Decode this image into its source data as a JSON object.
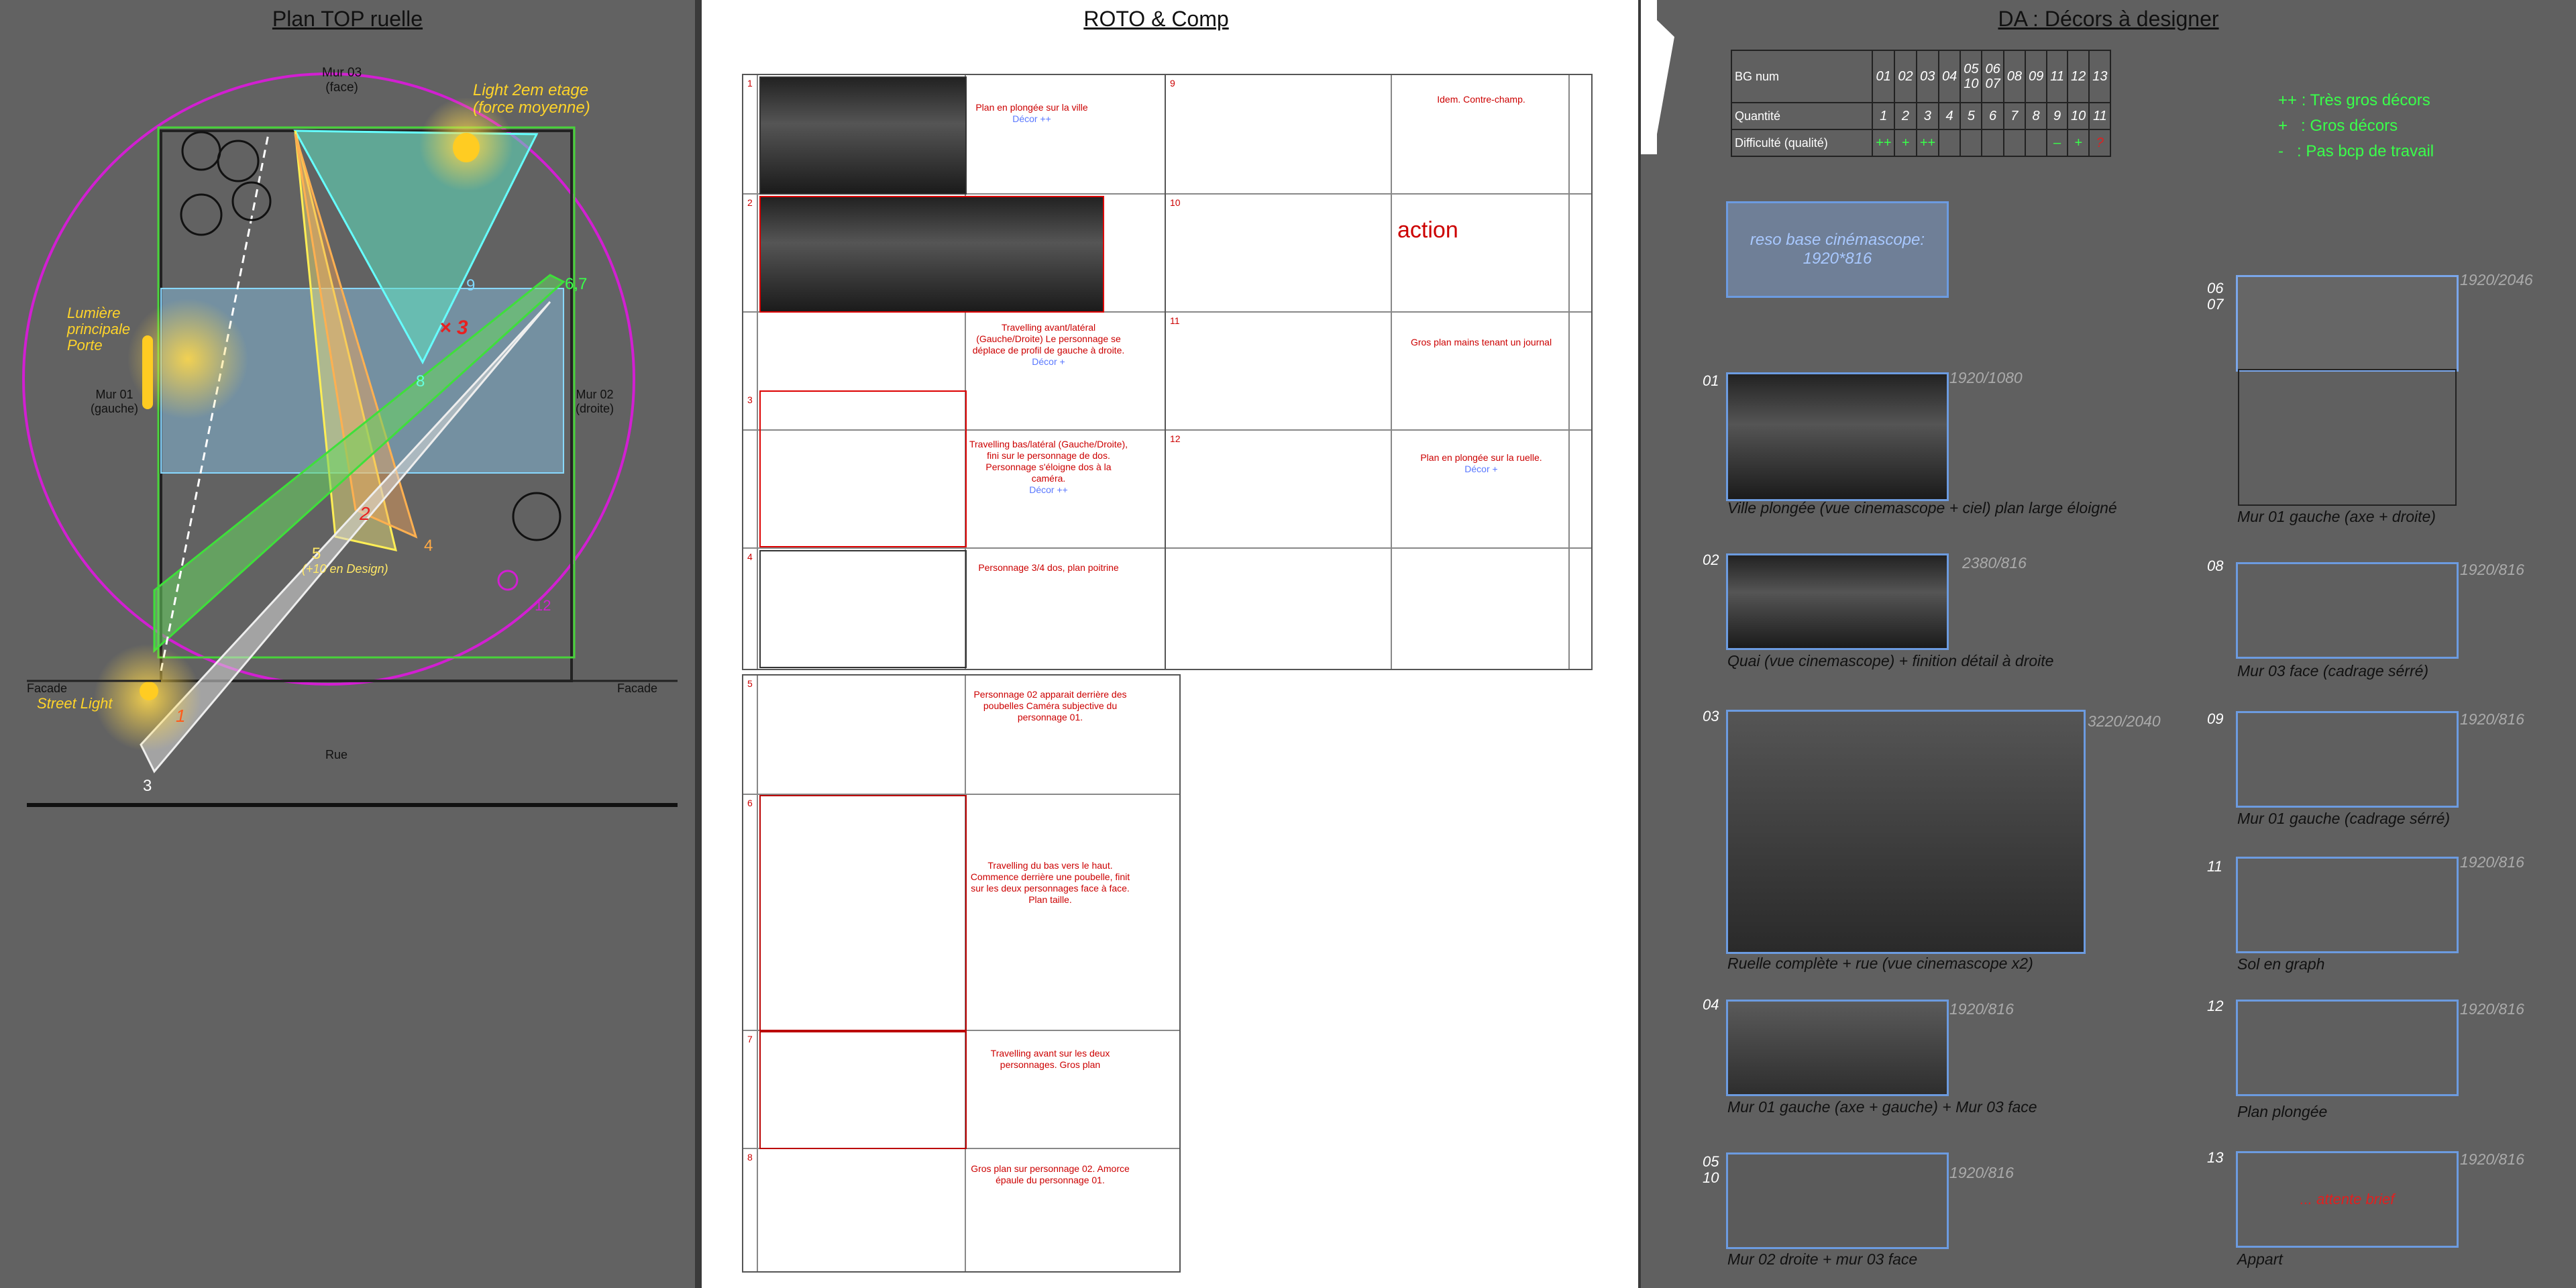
{
  "left": {
    "title": "Plan TOP ruelle",
    "labels": {
      "mur03": "Mur 03",
      "mur03_sub": "(face)",
      "light2": "Light 2em etage",
      "light2_sub": "(force moyenne)",
      "lumiere": "Lumière",
      "principale": "principale",
      "porte": "Porte",
      "mur01": "Mur 01",
      "mur01_sub": "(gauche)",
      "mur02": "Mur 02",
      "mur02_sub": "(droite)",
      "facade_l": "Facade",
      "facade_r": "Facade",
      "street": "Street Light",
      "rue": "Rue",
      "n9": "9",
      "n8": "8",
      "n3a": "× 3",
      "n5": "5",
      "n5sub": "(+10 en Design)",
      "n4": "4",
      "n2": "2",
      "n67": "6,7",
      "n12": "12",
      "n1": "1",
      "n3": "3"
    }
  },
  "mid": {
    "title": "ROTO & Comp",
    "shots_a": [
      {
        "n": "1",
        "text": "Plan en plongée sur la ville",
        "decor": "Décor ++"
      },
      {
        "n": "2",
        "text": "",
        "decor": ""
      },
      {
        "n": "",
        "text": "Travelling avant/latéral (Gauche/Droite) Le personnage se déplace de profil de gauche à droite.",
        "decor": "Décor +"
      },
      {
        "n": "3",
        "text": "Travelling bas/latéral (Gauche/Droite), fini sur le personnage de dos. Personnage s'éloigne dos à la caméra.",
        "decor": "Décor ++"
      },
      {
        "n": "4",
        "text": "Personnage 3/4 dos, plan poitrine",
        "decor": ""
      }
    ],
    "shots_b": [
      {
        "n": "9",
        "text": "Idem. Contre-champ.",
        "decor": ""
      },
      {
        "n": "10",
        "text": "action",
        "decor": ""
      },
      {
        "n": "11",
        "text": "Gros plan mains tenant un journal",
        "decor": ""
      },
      {
        "n": "12",
        "text": "Plan en plongée sur la ruelle.",
        "decor": "Décor +"
      }
    ],
    "shots_c": [
      {
        "n": "5",
        "text": "Personnage 02 apparait derrière des poubelles Caméra subjective du personnage 01."
      },
      {
        "n": "6",
        "text": "Travelling du bas vers le haut. Commence derrière une poubelle, finit sur les deux personnages face à face. Plan taille."
      },
      {
        "n": "7",
        "text": "Travelling avant sur les deux personnages. Gros plan"
      },
      {
        "n": "8",
        "text": "Gros plan sur personnage 02. Amorce épaule du personnage 01."
      }
    ]
  },
  "right": {
    "title": "DA : Décors à designer",
    "table": {
      "row_labels": [
        "BG num",
        "Quantité",
        "Difficulté (qualité)"
      ],
      "bg_num": [
        "01",
        "02",
        "03",
        "04",
        "05\n10",
        "06\n07",
        "08",
        "09",
        "11",
        "12",
        "13"
      ],
      "quantite": [
        "1",
        "2",
        "3",
        "4",
        "5",
        "6",
        "7",
        "8",
        "9",
        "10",
        "11"
      ],
      "difficulte": [
        "++",
        "+",
        "++",
        "",
        "",
        "",
        "",
        "",
        "–",
        "+",
        "?"
      ]
    },
    "legend": [
      "++ : Très gros décors",
      "+   : Gros décors",
      "-   : Pas bcp de travail"
    ],
    "reso": "reso base cinémascope: 1920*816",
    "decors": [
      {
        "id": "01",
        "res": "1920/1080",
        "cap": "Ville plongée (vue cinemascope + ciel) plan large éloigné"
      },
      {
        "id": "02",
        "res": "2380/816",
        "cap": "Quai (vue cinemascope) + finition détail à droite"
      },
      {
        "id": "03",
        "res": "3220/2040",
        "cap": "Ruelle complète + rue (vue cinemascope x2)"
      },
      {
        "id": "04",
        "res": "1920/816",
        "cap": "Mur 01 gauche (axe + gauche) + Mur 03 face"
      },
      {
        "id": "05\n10",
        "res": "1920/816",
        "cap": "Mur 02 droite + mur 03 face"
      },
      {
        "id": "06\n07",
        "res": "1920/2046",
        "cap": "Mur 01 gauche (axe + droite)"
      },
      {
        "id": "08",
        "res": "1920/816",
        "cap": "Mur 03 face (cadrage sérré)"
      },
      {
        "id": "09",
        "res": "1920/816",
        "cap": "Mur 01 gauche (cadrage sérré)"
      },
      {
        "id": "11",
        "res": "1920/816",
        "cap": "Sol en graph"
      },
      {
        "id": "12",
        "res": "1920/816",
        "cap": "Plan plongée"
      },
      {
        "id": "13",
        "res": "1920/816",
        "cap": "Appart",
        "note": "... attente brief"
      }
    ]
  }
}
